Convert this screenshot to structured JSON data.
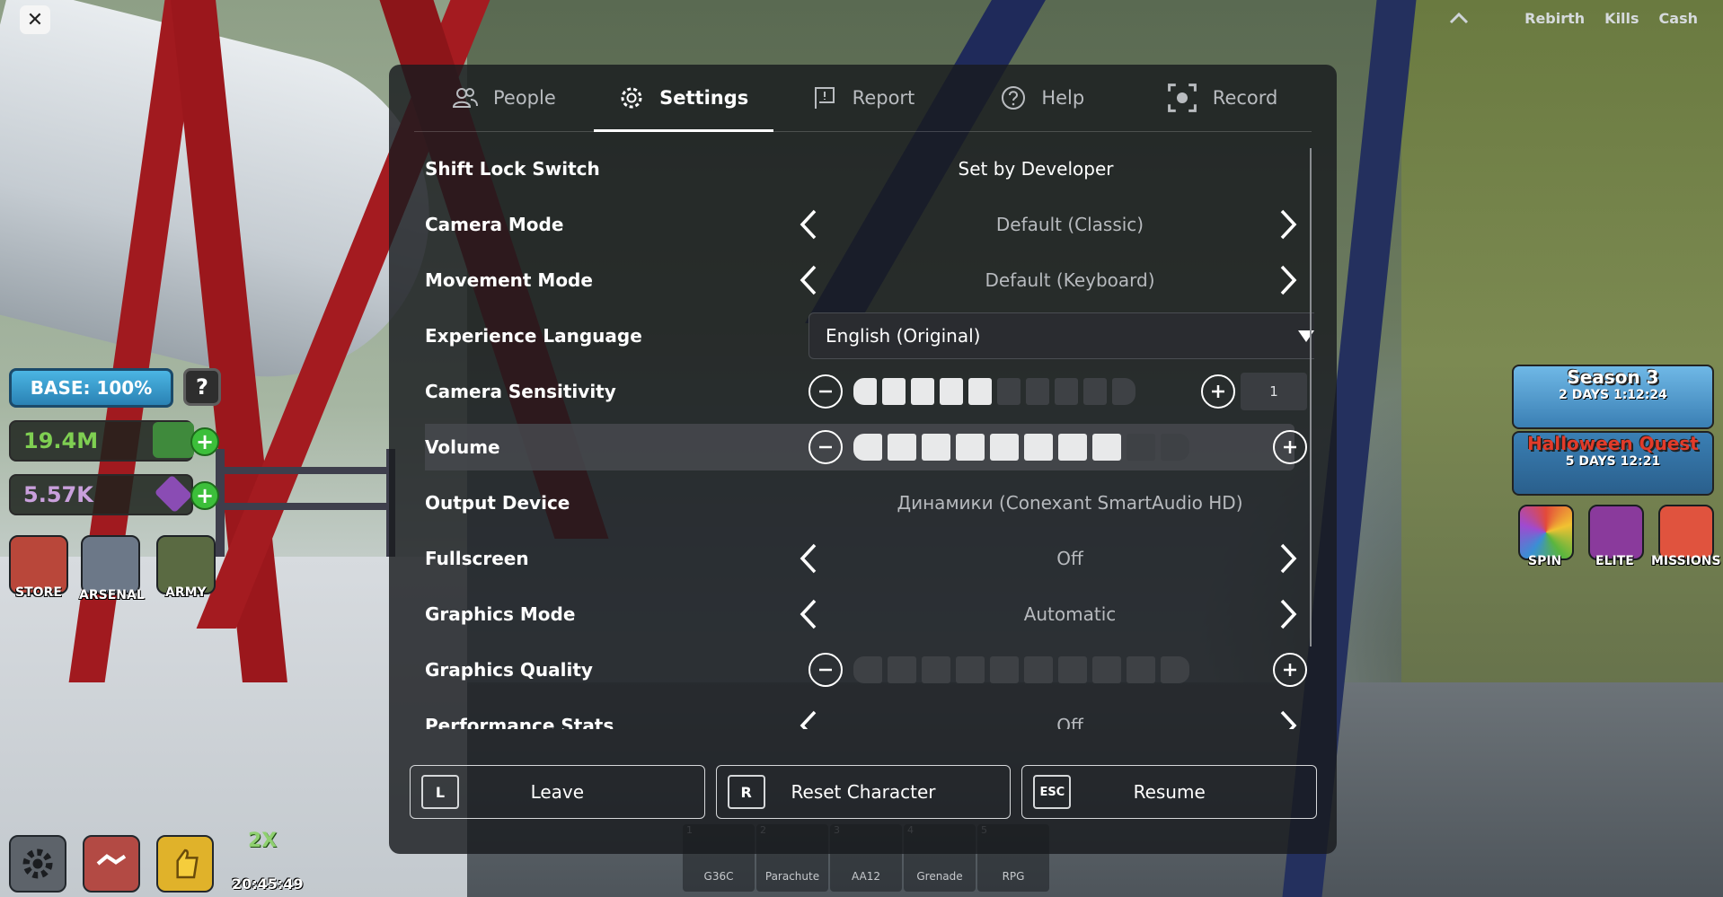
{
  "topbar": {
    "close_label": "✕",
    "stats": [
      "Rebirth",
      "Kills",
      "Cash"
    ],
    "caret": "^"
  },
  "menu": {
    "tabs": [
      {
        "label": "People",
        "icon": "people-icon"
      },
      {
        "label": "Settings",
        "icon": "gear-icon",
        "active": true
      },
      {
        "label": "Report",
        "icon": "flag-icon"
      },
      {
        "label": "Help",
        "icon": "help-icon"
      },
      {
        "label": "Record",
        "icon": "record-icon"
      }
    ],
    "settings": {
      "shift_lock": {
        "label": "Shift Lock Switch",
        "value": "Set by Developer"
      },
      "camera_mode": {
        "label": "Camera Mode",
        "value": "Default (Classic)"
      },
      "movement_mode": {
        "label": "Movement Mode",
        "value": "Default (Keyboard)"
      },
      "experience_language": {
        "label": "Experience Language",
        "value": "English (Original)"
      },
      "camera_sensitivity": {
        "label": "Camera Sensitivity",
        "level": 5,
        "max": 10,
        "value": "1"
      },
      "volume": {
        "label": "Volume",
        "level": 8,
        "max": 10
      },
      "output_device": {
        "label": "Output Device",
        "value": "Динамики (Conexant SmartAudio HD)"
      },
      "fullscreen": {
        "label": "Fullscreen",
        "value": "Off"
      },
      "graphics_mode": {
        "label": "Graphics Mode",
        "value": "Automatic"
      },
      "graphics_quality": {
        "label": "Graphics Quality",
        "level": 0,
        "max": 10
      },
      "performance_stats": {
        "label": "Performance Stats",
        "value": "Off"
      }
    },
    "actions": {
      "leave": {
        "key": "L",
        "label": "Leave"
      },
      "reset": {
        "key": "R",
        "label": "Reset Character"
      },
      "resume": {
        "key": "ESC",
        "label": "Resume"
      }
    }
  },
  "hud_left": {
    "base_label": "BASE: 100%",
    "help_label": "?",
    "cash": "19.4M",
    "gems": "5.57K",
    "apps": [
      "STORE",
      "ARSENAL",
      "ARMY"
    ],
    "boost_multiplier": "2X",
    "boost_timer": "20:45:49"
  },
  "hud_right": {
    "season_title": "Season 3",
    "season_time": "2 DAYS 1:12:24",
    "halloween_title": "Halloween Quest",
    "halloween_time": "5 DAYS 12:21",
    "apps": [
      "SPIN",
      "ELITE",
      "MISSIONS"
    ]
  },
  "hotbar": [
    {
      "num": "1",
      "label": "G36C"
    },
    {
      "num": "2",
      "label": "Parachute"
    },
    {
      "num": "3",
      "label": "AA12"
    },
    {
      "num": "4",
      "label": "Grenade"
    },
    {
      "num": "5",
      "label": "RPG"
    }
  ],
  "colors": {
    "panel_bg": "#191b1e",
    "active_segment": "#e8e9ea",
    "inactive_segment": "#3e4145",
    "cash_green": "#7fcf52",
    "base_blue": "#4bb5e3"
  }
}
